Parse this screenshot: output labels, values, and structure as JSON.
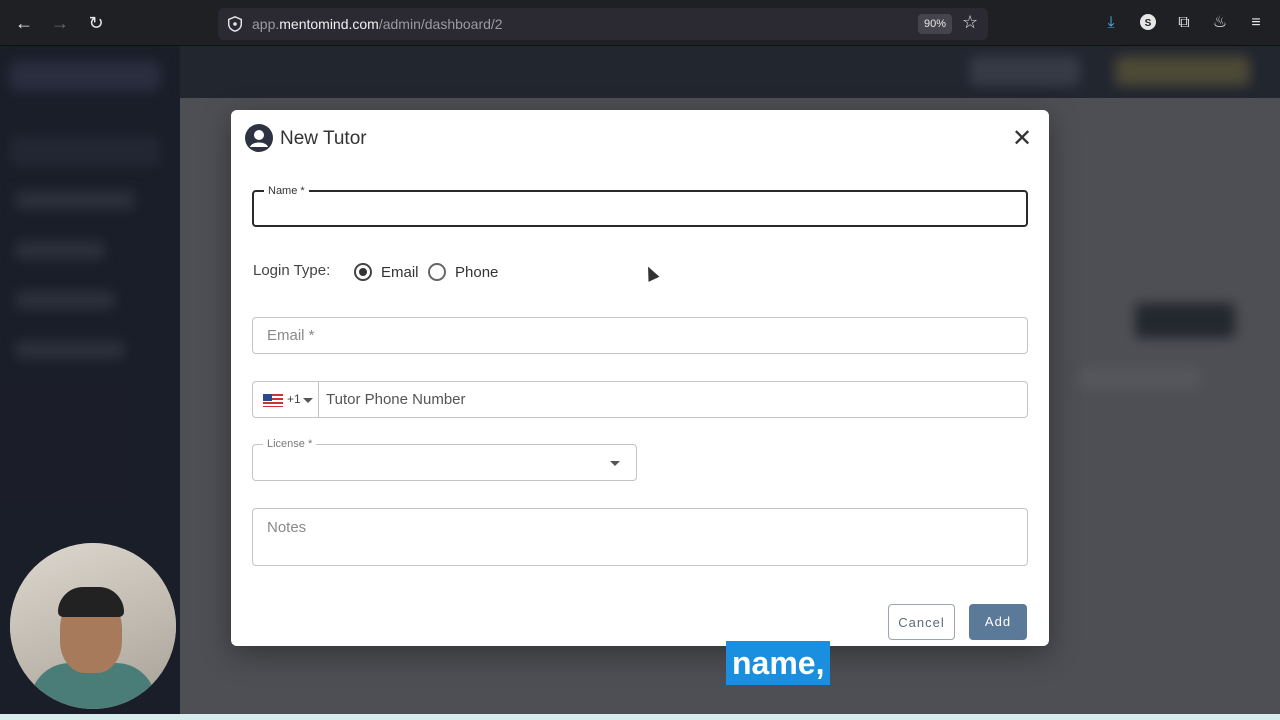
{
  "browser": {
    "url_prefix": "app.",
    "url_domain": "mentomind.com",
    "url_path": "/admin/dashboard/2",
    "zoom": "90%"
  },
  "modal": {
    "title": "New Tutor",
    "name_label": "Name *",
    "login_type_label": "Login Type:",
    "login_options": [
      {
        "label": "Email",
        "selected": true
      },
      {
        "label": "Phone",
        "selected": false
      }
    ],
    "email_placeholder": "Email *",
    "phone_country_code": "+1",
    "phone_placeholder": "Tutor Phone Number",
    "license_label": "License *",
    "notes_placeholder": "Notes",
    "cancel_label": "Cancel",
    "add_label": "Add"
  },
  "caption": "name,",
  "colors": {
    "add_button": "#5b7a99",
    "caption_bg": "#1a8fe0"
  }
}
